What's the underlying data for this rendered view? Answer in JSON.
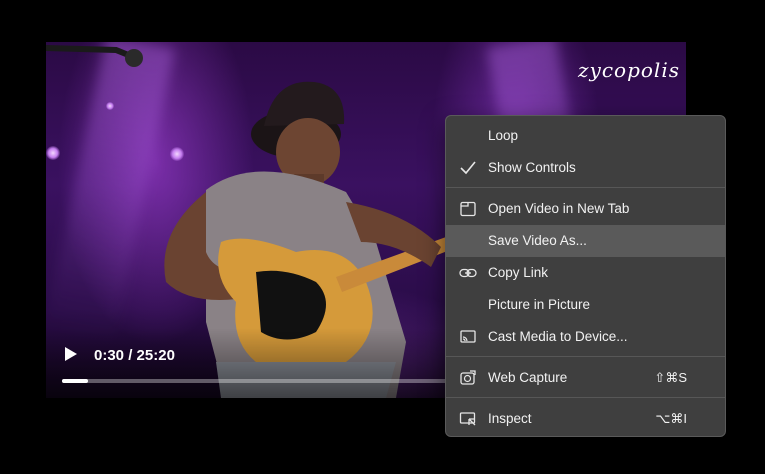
{
  "video": {
    "logo_text": "zycopolis",
    "current_time": "0:30",
    "duration": "25:20",
    "time_separator": " / ",
    "progress_fraction": 0.0197
  },
  "context_menu": {
    "items": [
      {
        "label": "Loop",
        "icon": "none",
        "shortcut": ""
      },
      {
        "label": "Show Controls",
        "icon": "checkmark-icon",
        "shortcut": ""
      },
      {
        "label": "Open Video in New Tab",
        "icon": "new-tab-icon",
        "shortcut": ""
      },
      {
        "label": "Save Video As...",
        "icon": "none",
        "shortcut": "",
        "highlighted": true
      },
      {
        "label": "Copy Link",
        "icon": "link-icon",
        "shortcut": ""
      },
      {
        "label": "Picture in Picture",
        "icon": "none",
        "shortcut": ""
      },
      {
        "label": "Cast Media to Device...",
        "icon": "cast-icon",
        "shortcut": ""
      },
      {
        "label": "Web Capture",
        "icon": "web-capture-icon",
        "shortcut": "⇧⌘S"
      },
      {
        "label": "Inspect",
        "icon": "inspect-icon",
        "shortcut": "⌥⌘I"
      }
    ]
  },
  "colors": {
    "menu_bg": "#3f3f3f",
    "menu_highlight": "#5a5a5a",
    "menu_text": "#f2f2f2",
    "stage_purple": "#3a1160"
  }
}
